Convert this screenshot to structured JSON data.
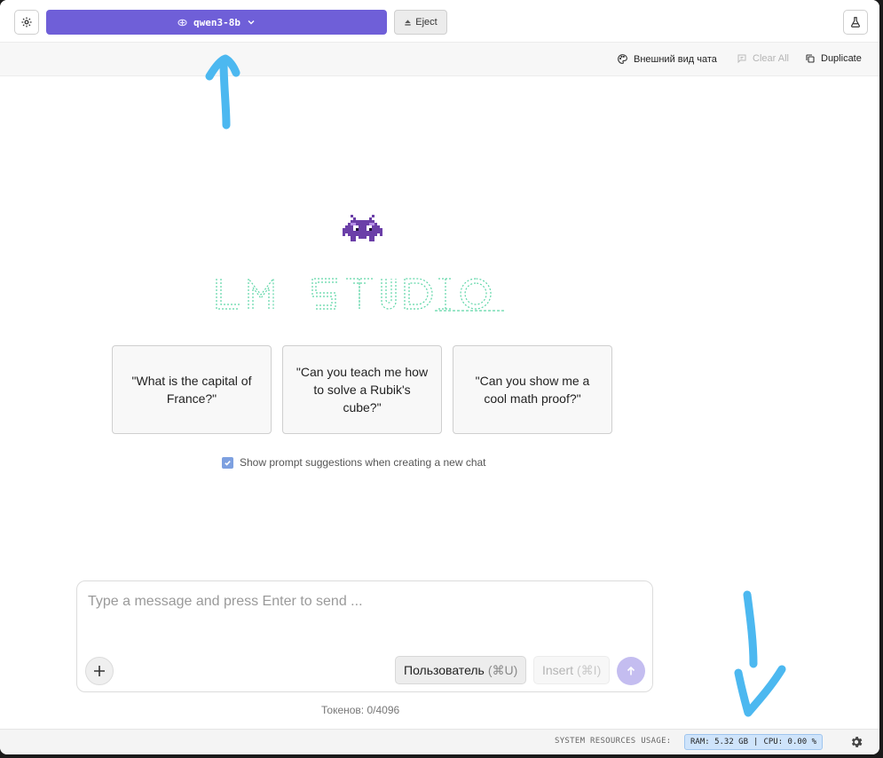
{
  "topbar": {
    "model_name": "qwen3-8b",
    "eject_label": "Eject"
  },
  "actionbar": {
    "appearance_label": "Внешний вид чата",
    "clear_all_label": "Clear All",
    "duplicate_label": "Duplicate"
  },
  "suggestions": [
    "\"What is the capital of France?\"",
    "\"Can you teach me how to solve a Rubik's cube?\"",
    "\"Can you show me a cool math proof?\""
  ],
  "show_suggestions_label": "Show prompt suggestions when creating a new chat",
  "composer": {
    "placeholder": "Type a message and press Enter to send ...",
    "role_label": "Пользователь",
    "role_shortcut": "(⌘U)",
    "insert_label": "Insert",
    "insert_shortcut": "(⌘I)"
  },
  "tokens_label": "Токенов: 0/4096",
  "status": {
    "resources_label": "SYSTEM RESOURCES USAGE:",
    "ram": "RAM: 5.32 GB",
    "cpu": "CPU: 0.00 %",
    "separator": "|"
  },
  "colors": {
    "accent": "#6f5fd8",
    "annotation": "#4cb8f0",
    "logo_green": "#5fd6a8"
  }
}
